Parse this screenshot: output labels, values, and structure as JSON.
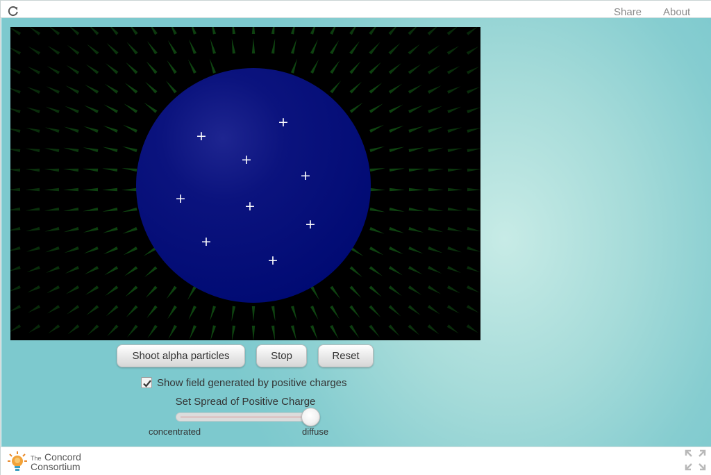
{
  "header": {
    "share_label": "Share",
    "about_label": "About",
    "reload_icon": "reload-icon"
  },
  "simulation": {
    "background_color": "#000000",
    "sphere_color": "#000a73",
    "field_vector_color": "#0f4a12",
    "charge_symbol": "+",
    "positive_charge_count": 9
  },
  "controls": {
    "shoot_label": "Shoot alpha particles",
    "stop_label": "Stop",
    "reset_label": "Reset",
    "show_field_label": "Show field generated by positive charges",
    "show_field_checked": true,
    "slider_title": "Set Spread of Positive Charge",
    "slider_min_label": "concentrated",
    "slider_max_label": "diffuse",
    "slider_value_fraction": 1.0
  },
  "footer": {
    "logo_small_text": "The",
    "logo_line1": "Concord",
    "logo_line2": "Consortium",
    "fullscreen_icon": "fullscreen-icon"
  },
  "colors": {
    "teal_background": "#8fd2d3",
    "button_text": "#333333",
    "link_text": "#8a8a8a"
  }
}
